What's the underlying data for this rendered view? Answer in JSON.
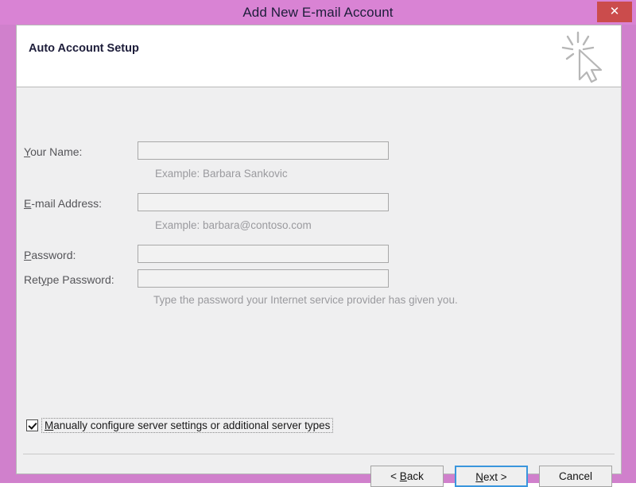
{
  "window": {
    "title": "Add New E-mail Account",
    "close_label": "✕",
    "titlebar_color": "#d983d4",
    "frame_color": "#d080cc",
    "close_color": "#cb4c4c"
  },
  "header": {
    "step_title": "Auto Account Setup",
    "icon": "click-cursor-icon"
  },
  "form": {
    "fields": [
      {
        "label_pre": "",
        "label_acc": "Y",
        "label_post": "our Name:",
        "value": "",
        "placeholder": "",
        "hint": "Example: Barbara Sankovic"
      },
      {
        "label_pre": "",
        "label_acc": "E",
        "label_post": "-mail Address:",
        "value": "",
        "placeholder": "",
        "hint": "Example: barbara@contoso.com"
      },
      {
        "label_pre": "",
        "label_acc": "P",
        "label_post": "assword:",
        "value": "",
        "placeholder": "",
        "hint": ""
      },
      {
        "label_pre": "Ret",
        "label_acc": "y",
        "label_post": "pe Password:",
        "value": "",
        "placeholder": "",
        "hint": "Type the password your Internet service provider has given you."
      }
    ]
  },
  "options": {
    "manual_checkbox_checked": true,
    "manual_label_pre": "",
    "manual_label_acc": "M",
    "manual_label_post": "anually configure server settings or additional server types"
  },
  "footer": {
    "buttons": [
      {
        "pre": "< ",
        "acc": "B",
        "post": "ack",
        "default": false
      },
      {
        "pre": "",
        "acc": "N",
        "post": "ext >",
        "default": true
      },
      {
        "pre": "Cancel",
        "acc": "",
        "post": "",
        "default": false
      }
    ]
  }
}
